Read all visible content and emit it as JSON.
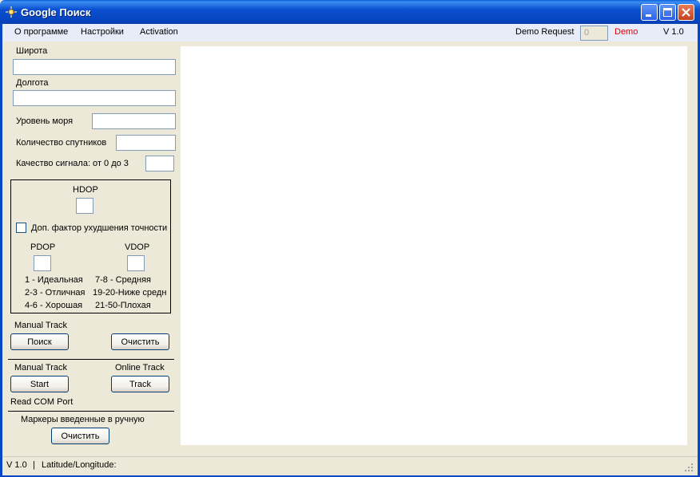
{
  "window": {
    "title": "Google Поиск"
  },
  "menu": {
    "items": [
      "О программе",
      "Настройки",
      "Activation"
    ],
    "demo_request_label": "Demo Request",
    "demo_request_value": "0",
    "demo_label": "Demo",
    "version_label": "V 1.0"
  },
  "form": {
    "latitude_label": "Широта",
    "longitude_label": "Долгота",
    "sea_level_label": "Уровень моря",
    "satellites_label": "Количество спутников",
    "signal_quality_label": "Качество сигнала: от 0 до 3"
  },
  "dop_group": {
    "hdop_label": "HDOP",
    "checkbox_label": "Доп. фактор ухудшения точности",
    "checkbox_checked": false,
    "pdop_label": "PDOP",
    "vdop_label": "VDOP",
    "legend_left": [
      "1 - Идеальная",
      "2-3 - Отличная",
      "4-6 - Хорошая"
    ],
    "legend_right": [
      "7-8 - Средняя",
      "19-20-Ниже средн",
      "21-50-Плохая"
    ]
  },
  "manual_track_section": {
    "title": "Manual Track",
    "search_button": "Поиск",
    "clear_button": "Очистить"
  },
  "track_section": {
    "manual_label": "Manual Track",
    "online_label": "Online Track",
    "start_button": "Start",
    "track_button": "Track",
    "com_port_label": "Read COM Port"
  },
  "markers_section": {
    "title": "Маркеры введенные в ручную",
    "clear_button": "Очистить"
  },
  "statusbar": {
    "version": "V 1.0",
    "divider": "|",
    "coords_label": "Latitude/Longitude:"
  },
  "colors": {
    "titlebar": "#0a4fd0",
    "demo_text": "#e00000",
    "window_bg": "#ece9d8",
    "map_bg": "#ffffff"
  }
}
